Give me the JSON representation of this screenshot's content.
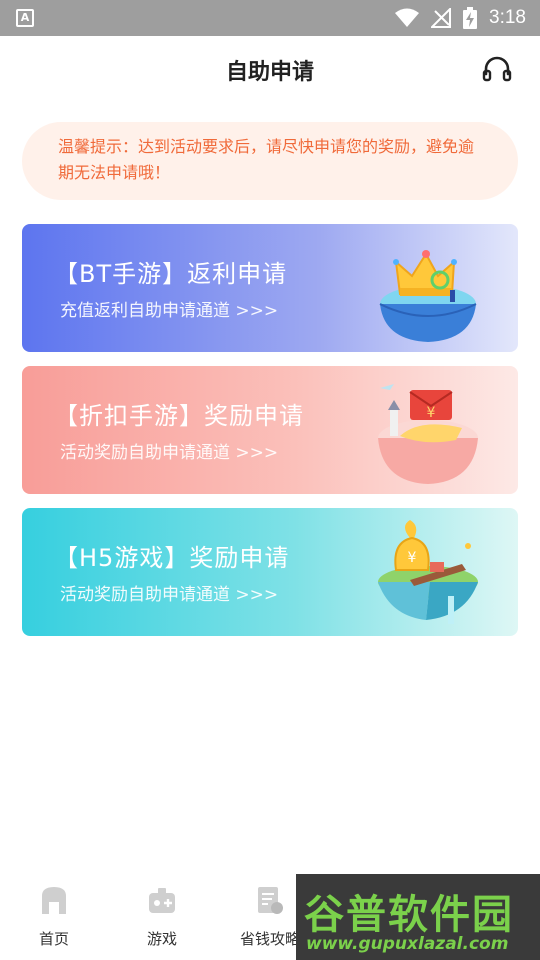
{
  "status_bar": {
    "time": "3:18",
    "left_icon": "a-letter-icon",
    "icons": [
      "wifi-icon",
      "signal-icon",
      "battery-charging-icon"
    ]
  },
  "header": {
    "title": "自助申请",
    "right_icon": "headset-icon"
  },
  "notice": {
    "text": "温馨提示：达到活动要求后，请尽快申请您的奖励，避免逾期无法申请哦！",
    "color": "#f06a3a",
    "background": "#fff1ea"
  },
  "cards": [
    {
      "title": "【BT手游】返利申请",
      "subtitle": "充值返利自助申请通道 >>>",
      "gradient_start": "#5d75ef",
      "icon": "crown-island-icon"
    },
    {
      "title": "【折扣手游】奖励申请",
      "subtitle": "活动奖励自助申请通道 >>>",
      "gradient_start": "#f89d98",
      "icon": "red-envelope-island-icon"
    },
    {
      "title": "【H5游戏】奖励申请",
      "subtitle": "活动奖励自助申请通道 >>>",
      "gradient_start": "#36cfdf",
      "icon": "money-bag-island-icon"
    }
  ],
  "bottom_nav": [
    {
      "label": "首页",
      "icon": "home-icon"
    },
    {
      "label": "游戏",
      "icon": "gamepad-icon"
    },
    {
      "label": "省钱攻略",
      "icon": "savings-guide-icon"
    }
  ],
  "watermark": {
    "logo": "谷普软件园",
    "url": "www.gupuxlazal.com"
  }
}
